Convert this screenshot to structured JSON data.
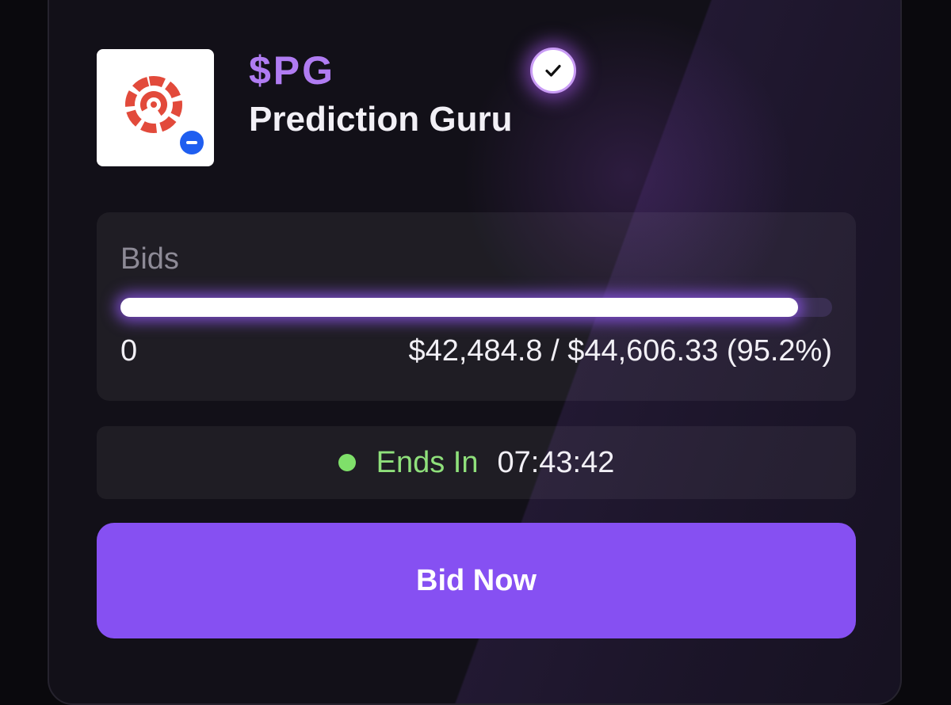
{
  "token": {
    "ticker": "$PG",
    "name": "Prediction Guru",
    "logo_icon": "prediction-guru-logo-icon",
    "chain_badge_icon": "chain-badge-icon",
    "verified_icon": "verified-check-icon"
  },
  "bids": {
    "label": "Bids",
    "min_label": "0",
    "amount_text": "$42,484.8 / $44,606.33 (95.2%)",
    "raised": 42484.8,
    "target": 44606.33,
    "progress_percent": 95.2
  },
  "auction": {
    "ends_label": "Ends In",
    "countdown": "07:43:42",
    "status_color": "#7fe06a"
  },
  "actions": {
    "bid_button_label": "Bid Now"
  },
  "colors": {
    "accent": "#8650f2",
    "ticker": "#b07cf2",
    "background": "#121018"
  }
}
